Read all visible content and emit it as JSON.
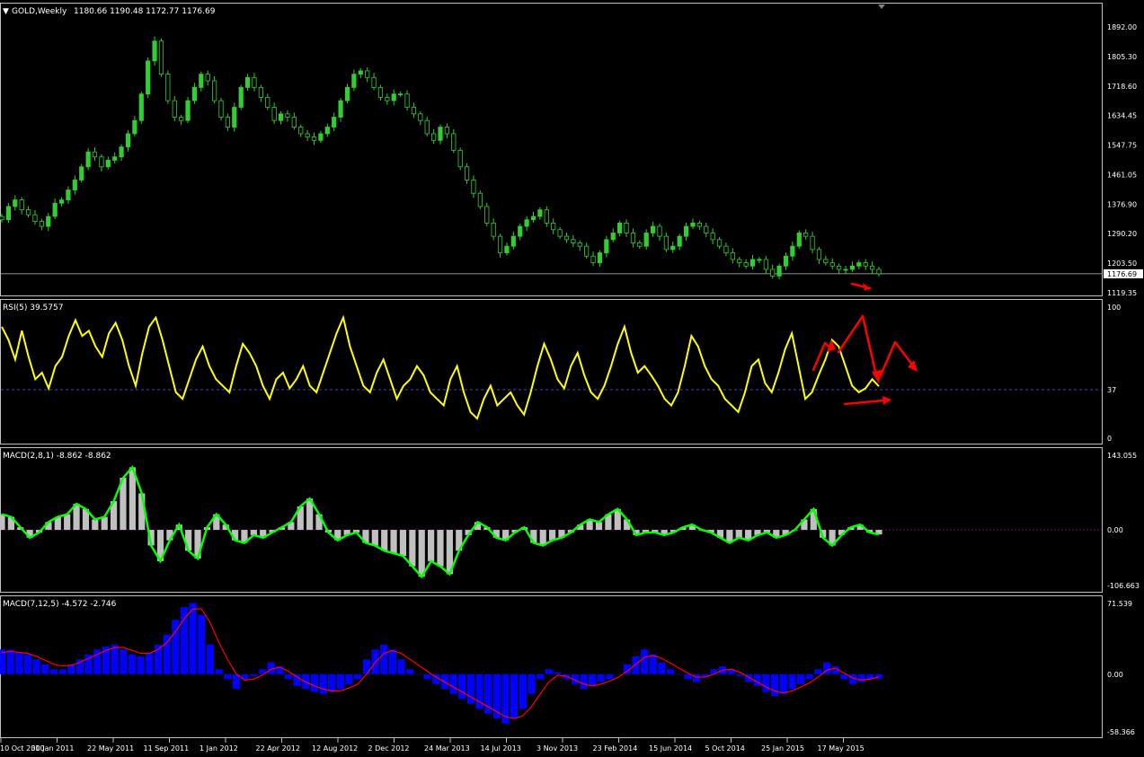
{
  "header": {
    "triangle": "▼",
    "symbol": "GOLD,Weekly",
    "ohlc": "1180.66 1190.48 1172.77 1176.69"
  },
  "colors": {
    "background": "#000000",
    "frame": "#c0c0c0",
    "text": "#ffffff",
    "price": "#32cd32",
    "rsi": "#ffff00",
    "macd1_line": "#00ff00",
    "macd1_hist": "#c0c0c0",
    "macd2_hist": "#0000ff",
    "macd2_signal": "#ff0000",
    "annotation": "#ff0000",
    "level_line": "#5a5aff"
  },
  "x_axis": {
    "labels": [
      "10 Oct 2010",
      "30 Jan 2011",
      "22 May 2011",
      "11 Sep 2011",
      "1 Jan 2012",
      "22 Apr 2012",
      "12 Aug 2012",
      "2 Dec 2012",
      "24 Mar 2013",
      "14 Jul 2013",
      "3 Nov 2013",
      "23 Feb 2014",
      "15 Jun 2014",
      "5 Oct 2014",
      "25 Jan 2015",
      "17 May 2015"
    ]
  },
  "chart_data": [
    {
      "type": "candlestick",
      "title": "GOLD,Weekly",
      "ylim": [
        1119.35,
        1950
      ],
      "y_ticks": [
        "1892.00",
        "1805.30",
        "1718.60",
        "1634.45",
        "1547.75",
        "1461.05",
        "1376.90",
        "1290.20",
        "1203.50",
        "1119.35"
      ],
      "current_price": "1176.69",
      "close_series": [
        1340,
        1380,
        1400,
        1370,
        1355,
        1335,
        1320,
        1350,
        1390,
        1400,
        1430,
        1460,
        1500,
        1545,
        1530,
        1500,
        1520,
        1530,
        1560,
        1600,
        1640,
        1720,
        1820,
        1880,
        1780,
        1700,
        1650,
        1640,
        1700,
        1740,
        1780,
        1760,
        1700,
        1650,
        1620,
        1680,
        1740,
        1770,
        1740,
        1710,
        1680,
        1640,
        1660,
        1650,
        1620,
        1600,
        1590,
        1580,
        1600,
        1620,
        1650,
        1700,
        1740,
        1780,
        1790,
        1770,
        1740,
        1710,
        1700,
        1720,
        1720,
        1680,
        1660,
        1640,
        1600,
        1580,
        1620,
        1600,
        1550,
        1500,
        1460,
        1420,
        1380,
        1330,
        1290,
        1240,
        1260,
        1290,
        1320,
        1340,
        1350,
        1370,
        1330,
        1310,
        1290,
        1280,
        1270,
        1260,
        1230,
        1210,
        1240,
        1280,
        1300,
        1330,
        1300,
        1270,
        1260,
        1300,
        1320,
        1290,
        1250,
        1260,
        1290,
        1320,
        1330,
        1320,
        1300,
        1280,
        1260,
        1240,
        1220,
        1210,
        1200,
        1220,
        1220,
        1190,
        1170,
        1200,
        1230,
        1260,
        1300,
        1290,
        1250,
        1220,
        1210,
        1200,
        1190,
        1190,
        1200,
        1210,
        1200,
        1190,
        1176.69
      ]
    },
    {
      "type": "line",
      "title": "RSI(5) 39.5757",
      "ylim": [
        0,
        100
      ],
      "y_ticks": [
        "100",
        "37",
        "0"
      ],
      "level": 37,
      "values": [
        85,
        75,
        60,
        82,
        62,
        45,
        50,
        38,
        55,
        62,
        78,
        90,
        78,
        82,
        70,
        62,
        80,
        88,
        75,
        55,
        40,
        65,
        85,
        92,
        75,
        55,
        35,
        30,
        45,
        60,
        70,
        55,
        45,
        40,
        35,
        55,
        72,
        65,
        55,
        40,
        30,
        45,
        50,
        38,
        45,
        55,
        40,
        35,
        50,
        65,
        80,
        92,
        70,
        55,
        40,
        35,
        50,
        60,
        45,
        30,
        40,
        45,
        55,
        48,
        35,
        30,
        25,
        45,
        55,
        35,
        20,
        15,
        30,
        40,
        25,
        30,
        35,
        25,
        18,
        35,
        55,
        72,
        60,
        45,
        38,
        55,
        65,
        48,
        35,
        30,
        40,
        55,
        72,
        85,
        65,
        50,
        55,
        48,
        40,
        30,
        25,
        35,
        55,
        78,
        70,
        55,
        45,
        40,
        30,
        25,
        20,
        35,
        55,
        60,
        42,
        35,
        50,
        68,
        80,
        55,
        30,
        35,
        48,
        60,
        75,
        70,
        55,
        40,
        35,
        38,
        45,
        39.5757
      ]
    },
    {
      "type": "bar+line",
      "title": "MACD(2,8,1) -8.862 -8.862",
      "ylim": [
        -106.663,
        143.055
      ],
      "y_ticks": [
        "143.055",
        "0.00",
        "-106.663"
      ],
      "values": [
        30,
        25,
        5,
        -15,
        -5,
        15,
        25,
        30,
        50,
        40,
        20,
        25,
        55,
        100,
        120,
        70,
        -30,
        -60,
        -20,
        10,
        -40,
        -55,
        5,
        30,
        10,
        -20,
        -25,
        -10,
        -15,
        -5,
        5,
        15,
        45,
        60,
        30,
        -5,
        -20,
        -10,
        -5,
        -25,
        -30,
        -40,
        -45,
        -50,
        -70,
        -90,
        -60,
        -70,
        -85,
        -40,
        -10,
        15,
        5,
        -15,
        -20,
        -5,
        5,
        -25,
        -30,
        -20,
        -15,
        -5,
        10,
        20,
        15,
        30,
        40,
        20,
        -10,
        -5,
        -5,
        -10,
        -5,
        5,
        10,
        0,
        -5,
        -15,
        -25,
        -15,
        -20,
        -10,
        -5,
        -15,
        -10,
        0,
        20,
        40,
        -15,
        -30,
        -10,
        5,
        10,
        -5,
        -8.862
      ]
    },
    {
      "type": "bar+line",
      "title": "MACD(7,12,5) -4.572 -2.746",
      "ylim": [
        -58.366,
        71.539
      ],
      "y_ticks": [
        "71.539",
        "0.00",
        "-58.366"
      ],
      "values": [
        25,
        25,
        22,
        20,
        15,
        10,
        5,
        5,
        10,
        15,
        20,
        25,
        28,
        30,
        25,
        20,
        18,
        22,
        30,
        40,
        55,
        68,
        72,
        60,
        30,
        5,
        -5,
        -15,
        -5,
        -2,
        5,
        12,
        8,
        -5,
        -12,
        -15,
        -18,
        -20,
        -18,
        -15,
        -10,
        -5,
        15,
        25,
        30,
        25,
        15,
        5,
        0,
        -5,
        -10,
        -15,
        -20,
        -25,
        -30,
        -35,
        -40,
        -45,
        -50,
        -45,
        -35,
        -20,
        -5,
        5,
        2,
        -5,
        -10,
        -15,
        -12,
        -8,
        -5,
        0,
        10,
        18,
        25,
        20,
        12,
        5,
        0,
        -5,
        -8,
        -3,
        5,
        8,
        5,
        -2,
        -8,
        -12,
        -18,
        -22,
        -20,
        -15,
        -10,
        -5,
        5,
        12,
        8,
        -5,
        -10,
        -8,
        -5,
        -4.572
      ],
      "signal": [
        22,
        23,
        22,
        21,
        18,
        14,
        10,
        8,
        9,
        12,
        16,
        20,
        24,
        27,
        27,
        24,
        21,
        21,
        25,
        32,
        43,
        56,
        66,
        66,
        52,
        32,
        15,
        0,
        -6,
        -5,
        -1,
        5,
        7,
        3,
        -3,
        -8,
        -12,
        -15,
        -17,
        -17,
        -14,
        -10,
        0,
        12,
        21,
        24,
        21,
        15,
        9,
        3,
        -3,
        -8,
        -13,
        -18,
        -23,
        -28,
        -33,
        -38,
        -43,
        -45,
        -42,
        -33,
        -20,
        -8,
        -1,
        -2,
        -6,
        -10,
        -12,
        -10,
        -7,
        -3,
        3,
        10,
        17,
        19,
        16,
        11,
        6,
        1,
        -3,
        -3,
        0,
        4,
        5,
        2,
        -3,
        -8,
        -13,
        -17,
        -19,
        -17,
        -13,
        -9,
        -3,
        4,
        6,
        1,
        -4,
        -6,
        -5,
        -2.746
      ]
    }
  ]
}
